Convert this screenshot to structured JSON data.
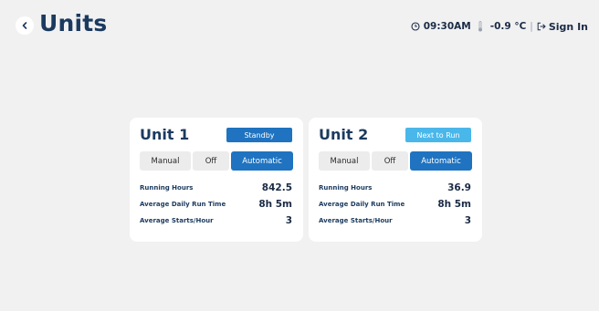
{
  "header": {
    "title": "Units",
    "time": "09:30AM",
    "temperature": "-0.9 °C",
    "separator": "|",
    "sign_in_label": "Sign In"
  },
  "icons": {
    "back": "chevron-left-icon",
    "clock": "clock-icon",
    "thermometer": "thermometer-icon",
    "sign_in": "sign-in-icon"
  },
  "colors": {
    "accent": "#1f73c0",
    "standby": "#1f73c0",
    "next_to_run": "#4ab7ea"
  },
  "units": [
    {
      "name": "Unit 1",
      "state": "Standby",
      "modes": [
        "Manual",
        "Off",
        "Automatic"
      ],
      "selected_mode": "Automatic",
      "stats": [
        {
          "label": "Running Hours",
          "value": "842.5"
        },
        {
          "label": "Average Daily Run Time",
          "value": "8h 5m"
        },
        {
          "label": "Average Starts/Hour",
          "value": "3"
        }
      ]
    },
    {
      "name": "Unit 2",
      "state": "Next to Run",
      "modes": [
        "Manual",
        "Off",
        "Automatic"
      ],
      "selected_mode": "Automatic",
      "stats": [
        {
          "label": "Running Hours",
          "value": "36.9"
        },
        {
          "label": "Average Daily Run Time",
          "value": "8h 5m"
        },
        {
          "label": "Average Starts/Hour",
          "value": "3"
        }
      ]
    }
  ]
}
